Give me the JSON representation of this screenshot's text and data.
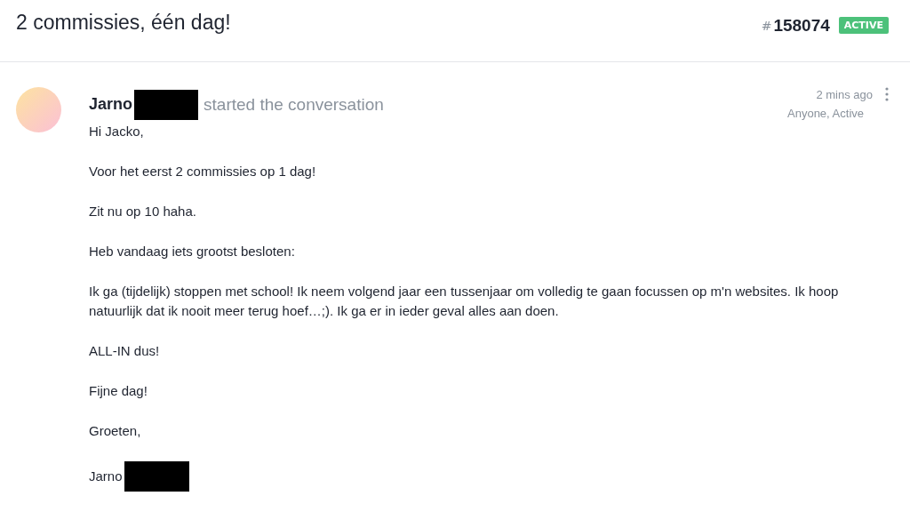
{
  "header": {
    "title": "2 commissies, één dag!",
    "hash": "#",
    "ticket_number": "158074",
    "status_badge": "ACTIVE"
  },
  "message": {
    "author": "Jarno",
    "action": "started the conversation",
    "time": "2 mins ago",
    "meta": "Anyone, Active",
    "paragraphs": [
      "Hi Jacko,",
      "Voor het eerst 2 commissies op 1 dag!",
      "Zit nu op 10 haha.",
      "Heb vandaag iets grootst besloten:",
      "Ik ga (tijdelijk) stoppen met school! Ik neem volgend jaar een tussenjaar om volledig te gaan focussen op m'n websites. Ik hoop natuurlijk dat ik nooit meer terug hoef…;). Ik ga er in ieder geval alles aan doen.",
      "ALL-IN dus!",
      "Fijne dag!",
      "Groeten,"
    ],
    "signature": "Jarno"
  }
}
